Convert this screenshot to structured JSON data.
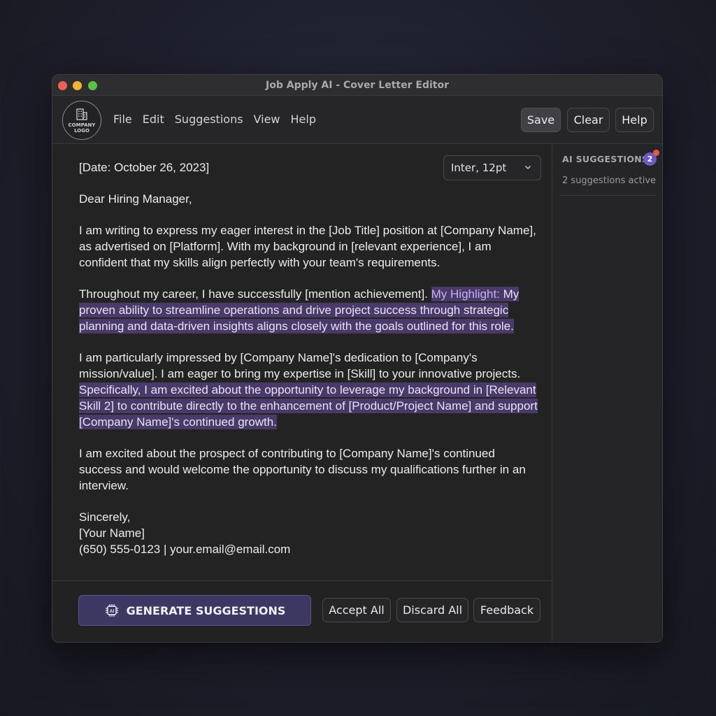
{
  "window": {
    "title": "Job Apply AI - Cover Letter Editor"
  },
  "logo": {
    "text": "COMPANY LOGO",
    "icon": "building-icon"
  },
  "menu": {
    "items": [
      "File",
      "Edit",
      "Suggestions",
      "View",
      "Help"
    ]
  },
  "toolbar": {
    "save_label": "Save",
    "clear_label": "Clear",
    "help_label": "Help"
  },
  "editor": {
    "font_select": "Inter, 12pt",
    "date": "[Date: October 26, 2023]",
    "greeting": "Dear Hiring Manager,",
    "para1": "I am writing to express my eager interest in the [Job Title] position at [Company Name], as advertised on [Platform]. With my background in [relevant experience], I am confident that my skills align perfectly with your team's requirements.",
    "para2_plain": "Throughout my career, I have successfully [mention achievement]. ",
    "para2_highlight_label": "My Highlight:",
    "para2_highlight": " My proven ability to streamline operations and drive project success through strategic planning and data-driven insights aligns closely with the goals outlined for this role.",
    "para3_plain": "I am particularly impressed by [Company Name]'s dedication to [Company's mission/value]. I am eager to bring my expertise in [Skill] to your innovative projects. ",
    "para3_highlight": "Specifically, I am excited about the opportunity to leverage my background in [Relevant Skill 2] to contribute directly to the enhancement of [Product/Project Name] and support [Company Name]'s continued growth.",
    "para4": "I am excited about the prospect of contributing to [Company Name]'s continued success and would welcome the opportunity to discuss my qualifications further in an interview.",
    "closing": "Sincerely,",
    "name": "[Your Name]",
    "contact": "(650) 555-0123 | your.email@email.com"
  },
  "footer": {
    "generate_label": "GENERATE SUGGESTIONS",
    "generate_icon": "ai-chip-icon",
    "accept_label": "Accept All",
    "discard_label": "Discard All",
    "feedback_label": "Feedback"
  },
  "sidebar": {
    "title": "AI SUGGESTIONS",
    "badge_count": "2",
    "status": "2 suggestions active"
  },
  "colors": {
    "highlight_bg": "#4a3a6a",
    "accent": "#6a5ac4",
    "notification": "#e8564a"
  }
}
